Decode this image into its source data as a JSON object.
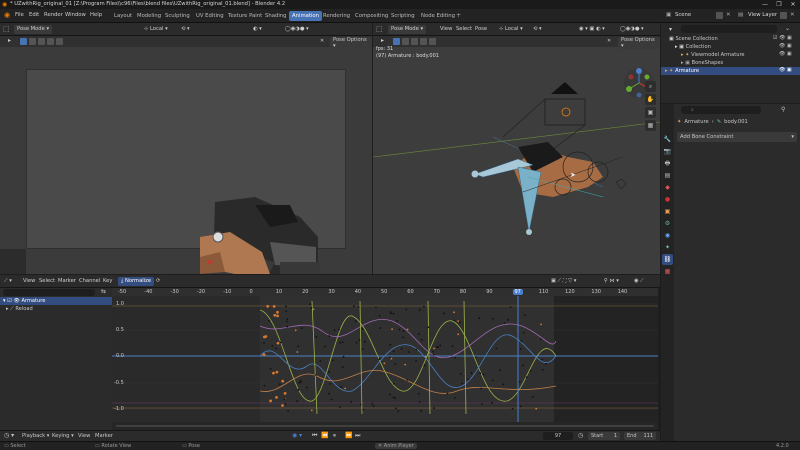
{
  "window": {
    "title": "* UZwithRig_original_01 [Z:\\Program Files\\\\c96\\Files\\blend files\\UZwithRig_original_01.blend] - Blender 4.2",
    "min": "—",
    "max": "❐",
    "close": "✕"
  },
  "menu": [
    "File",
    "Edit",
    "Render",
    "Window",
    "Help"
  ],
  "workspaces": [
    "Layout",
    "Modeling",
    "Sculpting",
    "UV Editing",
    "Texture Paint",
    "Shading",
    "Animation",
    "Rendering",
    "Compositing",
    "Scripting",
    "Node Editing"
  ],
  "active_workspace": "Animation",
  "scene": {
    "name": "Scene",
    "view_layer": "View Layer"
  },
  "left_view": {
    "mode": "Pose Mode",
    "orientation": "Local",
    "pose_options": "Pose Options"
  },
  "right_view": {
    "mode": "Pose Mode",
    "menus": [
      "View",
      "Select",
      "Pose"
    ],
    "orientation": "Local",
    "pose_options": "Pose Options",
    "info_fps": "fps: 31",
    "info_object": "(97) Armature : body.001"
  },
  "outliner": {
    "items": [
      {
        "label": "Scene Collection",
        "indent": 0,
        "selected": false
      },
      {
        "label": "Collection",
        "indent": 1,
        "selected": false
      },
      {
        "label": "Viewmodel Armature",
        "indent": 2,
        "selected": false
      },
      {
        "label": "BoneShapes",
        "indent": 2,
        "selected": false
      },
      {
        "label": "Armature",
        "indent": 1,
        "selected": true
      }
    ]
  },
  "properties": {
    "search_placeholder": "",
    "breadcrumb_obj": "Armature",
    "breadcrumb_bone": "body.001",
    "add_constraint": "Add Bone Constraint"
  },
  "graph": {
    "menus": [
      "View",
      "Select",
      "Marker",
      "Channel",
      "Key"
    ],
    "normalize": "Normalize",
    "search_placeholder": "",
    "channels": [
      {
        "label": "Armature",
        "selected": true
      },
      {
        "label": "Reload",
        "selected": false
      }
    ],
    "ruler_labels": [
      "-50",
      "-40",
      "-30",
      "-20",
      "-10",
      "0",
      "10",
      "20",
      "30",
      "40",
      "50",
      "60",
      "70",
      "80",
      "90",
      "97",
      "110",
      "120",
      "130",
      "140"
    ],
    "current_frame": "97",
    "value_labels": [
      "1.0",
      "0.5",
      "0.0",
      "-0.5",
      "-1.0"
    ]
  },
  "playback_bar": {
    "playback": "Playback",
    "keying": "Keying",
    "view": "View",
    "marker": "Marker",
    "frame": "97",
    "start_label": "Start",
    "start": "1",
    "end_label": "End",
    "end": "111"
  },
  "status": {
    "select": "Select",
    "rotate": "Rotate View",
    "pose": "Pose",
    "anim_player": "Anim Player",
    "version": "4.2.0"
  },
  "colors": {
    "accent": "#4772b3",
    "playhead": "#4a7fd0",
    "keyframe_orange": "#d9782e",
    "curve_green": "#9cb44a",
    "curve_blue": "#4a7fc0"
  }
}
